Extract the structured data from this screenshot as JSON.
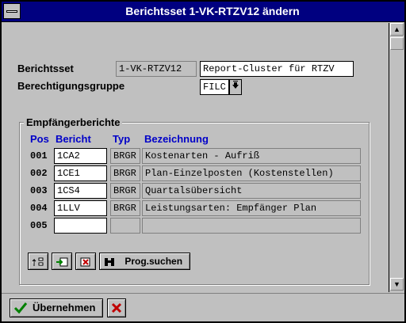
{
  "window": {
    "title": "Berichtsset 1-VK-RTZV12 ändern"
  },
  "form": {
    "berichtsset_label": "Berichtsset",
    "berichtsset_code": "1-VK-RTZV12",
    "berichtsset_name": "Report-Cluster für RTZV",
    "berechtigungsgruppe_label": "Berechtigungsgruppe",
    "berechtigungsgruppe_value": "FILC"
  },
  "group": {
    "title": "Empfängerberichte",
    "headers": {
      "pos": "Pos",
      "bericht": "Bericht",
      "typ": "Typ",
      "bezeichnung": "Bezeichnung"
    },
    "rows": [
      {
        "pos": "001",
        "bericht": "1CA2",
        "typ": "BRGR",
        "bezeichnung": "Kostenarten - Aufriß"
      },
      {
        "pos": "002",
        "bericht": "1CE1",
        "typ": "BRGR",
        "bezeichnung": "Plan-Einzelposten (Kostenstellen)"
      },
      {
        "pos": "003",
        "bericht": "1CS4",
        "typ": "BRGR",
        "bezeichnung": "Quartalsübersicht"
      },
      {
        "pos": "004",
        "bericht": "1LLV",
        "typ": "BRGR",
        "bezeichnung": "Leistungsarten: Empfänger Plan"
      },
      {
        "pos": "005",
        "bericht": "",
        "typ": "",
        "bezeichnung": ""
      }
    ]
  },
  "toolbar": {
    "prog_suchen_label": "Prog.suchen"
  },
  "footer": {
    "ok_label": "Übernehmen"
  },
  "icons": {
    "system_menu": "system-menu-icon",
    "scroll_up": "arrow-up-icon",
    "scroll_down": "arrow-down-icon",
    "dropdown": "dropdown-arrow-icon",
    "toolbar_1": "reorder-icon",
    "toolbar_2": "insert-row-icon",
    "toolbar_3": "delete-row-icon",
    "search": "binoculars-icon",
    "ok": "checkmark-icon",
    "cancel": "cancel-x-icon"
  },
  "colors": {
    "titlebar": "#000080",
    "header_text": "#0000c8",
    "ok_check": "#008000",
    "cancel_x": "#c00000"
  }
}
